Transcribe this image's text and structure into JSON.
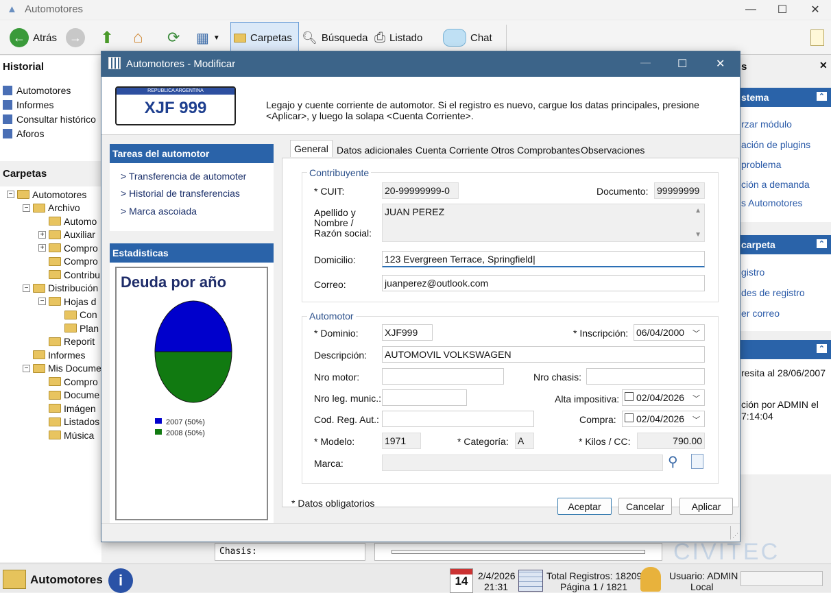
{
  "app": {
    "title": "Automotores",
    "statusbar_app": "Automotores"
  },
  "toolbar": {
    "back": "Atrás",
    "carpetas": "Carpetas",
    "busqueda": "Búsqueda",
    "listado": "Listado",
    "chat": "Chat"
  },
  "historial": {
    "title": "Historial",
    "items": [
      "Automotores",
      "Informes",
      "Consultar histórico",
      "Aforos"
    ]
  },
  "carpetas": {
    "title": "Carpetas",
    "tree": [
      {
        "label": "Automotores",
        "level": 0,
        "exp": "minus"
      },
      {
        "label": "Archivo",
        "level": 1,
        "exp": "minus"
      },
      {
        "label": "Automo",
        "level": 2,
        "exp": ""
      },
      {
        "label": "Auxiliar",
        "level": 2,
        "exp": "plus"
      },
      {
        "label": "Compro",
        "level": 2,
        "exp": "plus"
      },
      {
        "label": "Compro",
        "level": 2,
        "exp": ""
      },
      {
        "label": "Contribu",
        "level": 2,
        "exp": ""
      },
      {
        "label": "Distribución",
        "level": 1,
        "exp": "minus"
      },
      {
        "label": "Hojas d",
        "level": 2,
        "exp": "minus"
      },
      {
        "label": "Con",
        "level": 3,
        "exp": ""
      },
      {
        "label": "Plan",
        "level": 3,
        "exp": ""
      },
      {
        "label": "Reporit",
        "level": 2,
        "exp": ""
      },
      {
        "label": "Informes",
        "level": 1,
        "exp": ""
      },
      {
        "label": "Mis Docume",
        "level": 1,
        "exp": "minus"
      },
      {
        "label": "Compro",
        "level": 2,
        "exp": ""
      },
      {
        "label": "Docume",
        "level": 2,
        "exp": ""
      },
      {
        "label": "Imágen",
        "level": 2,
        "exp": ""
      },
      {
        "label": "Listados",
        "level": 2,
        "exp": ""
      },
      {
        "label": "Música",
        "level": 2,
        "exp": ""
      }
    ]
  },
  "right_panel": {
    "partial_header": "s",
    "sistema": {
      "title": "stema",
      "links": [
        "rzar módulo",
        "ación de plugins",
        "problema",
        "ción a demanda",
        "s Automotores"
      ]
    },
    "carpeta": {
      "title": "carpeta",
      "links": [
        "gistro",
        "des de registro",
        "er correo"
      ]
    },
    "info": {
      "lines": [
        "resita al 28/06/2007",
        "ción por ADMIN el",
        "7:14:04"
      ]
    }
  },
  "background": {
    "chasis": "Chasis:",
    "logo": "CIVITEC"
  },
  "status": {
    "date": "2/4/2026",
    "time": "21:31",
    "cal_day": "14",
    "total": "Total Registros: 18209",
    "page": "Página 1 / 1821",
    "user": "Usuario: ADMIN",
    "mode": "Local"
  },
  "dialog": {
    "title": "Automotores - Modificar",
    "plate": {
      "country": "REPUBLICA ARGENTINA",
      "number": "XJF 999"
    },
    "description": "Legajo y cuente corriente de automotor. Si el registro es nuevo, cargue los datas principales, presione <Aplicar>, y luego la solapa <Cuenta Corriente>.",
    "tasks": {
      "title": "Tareas del automotor",
      "links": [
        "> Transferencia de automoter",
        "> Historial de transferencias",
        "> Marca ascoiada"
      ]
    },
    "stats": {
      "title": "Estadisticas"
    },
    "tabs": [
      "General",
      "Datos adicionales",
      "Cuenta Corriente",
      "Otros Comprobantes",
      "Observaciones"
    ],
    "contribuyente": {
      "legend": "Contribuyente",
      "cuit_label": "* CUIT:",
      "cuit": "20-99999999-0",
      "doc_label": "Documento:",
      "doc": "99999999",
      "name_label": "Apellido y Nombre / Razón social:",
      "name": "JUAN PEREZ",
      "dom_label": "Domicilio:",
      "dom": "123 Evergreen Terrace, Springfield",
      "mail_label": "Correo:",
      "mail": "juanperez@outlook.com"
    },
    "automotor": {
      "legend": "Automotor",
      "dominio_label": "* Dominio:",
      "dominio": "XJF999",
      "insc_label": "* Inscripción:",
      "insc": "06/04/2000",
      "desc_label": "Descripción:",
      "desc": "AUTOMOVIL VOLKSWAGEN",
      "motor_label": "Nro motor:",
      "motor": "",
      "chasis_label": "Nro chasis:",
      "chasis": "",
      "leg_label": "Nro leg. munic.:",
      "leg": "",
      "alta_label": "Alta impositiva:",
      "alta": "02/04/2026",
      "cod_label": "Cod. Reg. Aut.:",
      "cod": "",
      "compra_label": "Compra:",
      "compra": "02/04/2026",
      "modelo_label": "* Modelo:",
      "modelo": "1971",
      "cat_label": "* Categoría:",
      "cat": "A",
      "kilos_label": "* Kilos / CC:",
      "kilos": "790.00",
      "marca_label": "Marca:",
      "marca": ""
    },
    "required_note": "* Datos obligatorios",
    "buttons": {
      "ok": "Aceptar",
      "cancel": "Cancelar",
      "apply": "Aplicar"
    }
  },
  "chart_data": {
    "type": "pie",
    "title": "Deuda por año",
    "categories": [
      "2007 (50%)",
      "2008 (50%)"
    ],
    "values": [
      50,
      50
    ],
    "colors": [
      "#0000cc",
      "#117a11"
    ]
  }
}
